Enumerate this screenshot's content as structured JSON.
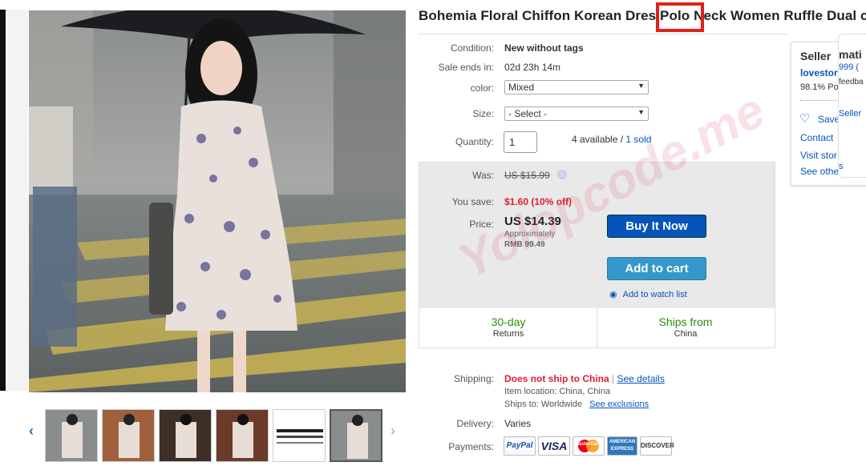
{
  "listing": {
    "title_part1": "Bohemia Floral Chiffon Korean Dres",
    "title_highlight": "Polo",
    "title_part2": "Neck Women Ruffle Dual c"
  },
  "details": {
    "condition_label": "Condition:",
    "condition_value": "New without tags",
    "sale_label": "Sale ends in:",
    "sale_value": "02d 23h 14m",
    "color_label": "color:",
    "color_value": "Mixed",
    "size_label": "Size:",
    "size_value": "- Select -",
    "quantity_label": "Quantity:",
    "quantity_value": "1",
    "available_text": "4 available /",
    "sold_text": "1 sold"
  },
  "pricing": {
    "was_label": "Was:",
    "was_value": "US $15.99",
    "save_label": "You save:",
    "save_value": "$1.60 (10% off)",
    "price_label": "Price:",
    "price_value": "US $14.39",
    "approx_label": "Approximately",
    "approx_value": "RMB 99.49",
    "buy_label": "Buy It Now",
    "cart_label": "Add to cart",
    "watch_label": "Add to watch list"
  },
  "strip": {
    "returns_title": "30-day",
    "returns_sub": "Returns",
    "ships_title": "Ships from",
    "ships_sub": "China"
  },
  "shipping": {
    "shipping_label": "Shipping:",
    "no_ship": "Does not ship to China",
    "see_details": "See details",
    "item_location": "Item location:  China, China",
    "ships_to": "Ships to:  Worldwide",
    "see_exclusions": "See exclusions",
    "delivery_label": "Delivery:",
    "delivery_value": "Varies",
    "payments_label": "Payments:"
  },
  "payments": [
    "PayPal",
    "VISA",
    "MasterCard",
    "AMERICAN EXPRESS",
    "DISCOVER"
  ],
  "seller": {
    "heading": "Seller",
    "name": "lovestor",
    "feedback": "98.1% Po",
    "save": "Save",
    "contact": "Contact",
    "visit": "Visit stor",
    "see_other": "See othe"
  },
  "popup": {
    "heading": "mati",
    "score": "999 (",
    "feedback": "feedba",
    "seller": "Seller",
    "s": "s"
  },
  "watermark": "Yolopcode.me",
  "colors": {
    "link": "#0654ba",
    "buy": "#0654ba",
    "cart": "#3498ca",
    "red": "#dd1e31",
    "green": "#2a8f0c",
    "highlight_box": "#e0201b"
  }
}
